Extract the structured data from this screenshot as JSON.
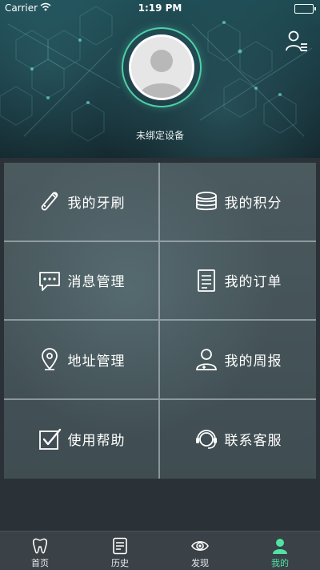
{
  "status_bar": {
    "carrier": "Carrier",
    "time": "1:19 PM"
  },
  "profile": {
    "device_status": "未绑定设备"
  },
  "menu": [
    {
      "label": "我的牙刷",
      "icon": "toothbrush-icon"
    },
    {
      "label": "我的积分",
      "icon": "coins-stack-icon"
    },
    {
      "label": "消息管理",
      "icon": "chat-bubble-icon"
    },
    {
      "label": "我的订单",
      "icon": "document-icon"
    },
    {
      "label": "地址管理",
      "icon": "location-pin-icon"
    },
    {
      "label": "我的周报",
      "icon": "doctor-icon"
    },
    {
      "label": "使用帮助",
      "icon": "checkbox-icon"
    },
    {
      "label": "联系客服",
      "icon": "headset-icon"
    }
  ],
  "tabs": [
    {
      "label": "首页",
      "icon": "tooth-icon",
      "active": false
    },
    {
      "label": "历史",
      "icon": "history-document-icon",
      "active": false
    },
    {
      "label": "发现",
      "icon": "eye-icon",
      "active": false
    },
    {
      "label": "我的",
      "icon": "person-icon",
      "active": true
    }
  ],
  "colors": {
    "accent": "#4fe3a6",
    "tabbar": "#3a4147",
    "page_bg": "#2a3137"
  }
}
